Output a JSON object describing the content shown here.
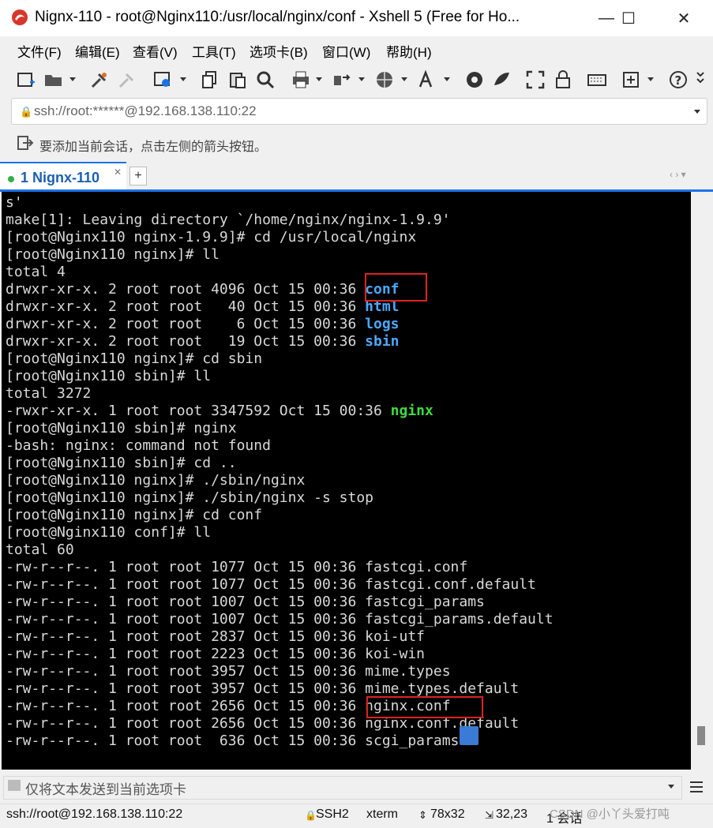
{
  "window": {
    "title": "Nignx-110 - root@Nginx110:/usr/local/nginx/conf - Xshell 5 (Free for Ho...",
    "minimize_glyph": "—",
    "maximize_glyph": "☐",
    "close_glyph": "✕"
  },
  "menu": [
    "文件(F)",
    "编辑(E)",
    "查看(V)",
    "工具(T)",
    "选项卡(B)",
    "窗口(W)",
    "帮助(H)"
  ],
  "address": {
    "value": "ssh://root:******@192.168.138.110:22"
  },
  "hint": {
    "text": "要添加当前会话，点击左侧的箭头按钮。"
  },
  "tabs": {
    "active_label": "1 Nignx-110",
    "add_label": "+",
    "nav_label": "‹ › ▾"
  },
  "terminal": {
    "lines": [
      "s'",
      "make[1]: Leaving directory `/home/nginx/nginx-1.9.9'",
      "[root@Nginx110 nginx-1.9.9]# cd /usr/local/nginx",
      "[root@Nginx110 nginx]# ll",
      "total 4",
      "drwxr-xr-x. 2 root root 4096 Oct 15 00:36 conf",
      "drwxr-xr-x. 2 root root   40 Oct 15 00:36 html",
      "drwxr-xr-x. 2 root root    6 Oct 15 00:36 logs",
      "drwxr-xr-x. 2 root root   19 Oct 15 00:36 sbin",
      "[root@Nginx110 nginx]# cd sbin",
      "[root@Nginx110 sbin]# ll",
      "total 3272",
      "-rwxr-xr-x. 1 root root 3347592 Oct 15 00:36 nginx",
      "[root@Nginx110 sbin]# nginx",
      "-bash: nginx: command not found",
      "[root@Nginx110 sbin]# cd ..",
      "[root@Nginx110 nginx]# ./sbin/nginx",
      "[root@Nginx110 nginx]# ./sbin/nginx -s stop",
      "[root@Nginx110 nginx]# cd conf",
      "[root@Nginx110 conf]# ll",
      "total 60",
      "-rw-r--r--. 1 root root 1077 Oct 15 00:36 fastcgi.conf",
      "-rw-r--r--. 1 root root 1077 Oct 15 00:36 fastcgi.conf.default",
      "-rw-r--r--. 1 root root 1007 Oct 15 00:36 fastcgi_params",
      "-rw-r--r--. 1 root root 1007 Oct 15 00:36 fastcgi_params.default",
      "-rw-r--r--. 1 root root 2837 Oct 15 00:36 koi-utf",
      "-rw-r--r--. 1 root root 2223 Oct 15 00:36 koi-win",
      "-rw-r--r--. 1 root root 3957 Oct 15 00:36 mime.types",
      "-rw-r--r--. 1 root root 3957 Oct 15 00:36 mime.types.default",
      "-rw-r--r--. 1 root root 2656 Oct 15 00:36 nginx.conf",
      "-rw-r--r--. 1 root root 2656 Oct 15 00:36 nginx.conf.default",
      "-rw-r--r--. 1 root root  636 Oct 15 00:36 scgi_params"
    ],
    "dir_names": [
      "conf",
      "html",
      "logs",
      "sbin"
    ],
    "exe_names": [
      "nginx"
    ],
    "colors": {
      "background": "#000000",
      "text": "#d8d8d8",
      "directory": "#4aa8ff",
      "executable": "#3ddc3d",
      "highlight_box": "#e02020"
    }
  },
  "sendbar": {
    "placeholder": "仅将文本发送到当前选项卡"
  },
  "status": {
    "connection": "ssh://root@192.168.138.110:22",
    "protocol": "SSH2",
    "term": "xterm",
    "size": "78x32",
    "cursor": "32,23",
    "sessions": "1 会话"
  },
  "watermark": "CSDN @小丫头爱打吨"
}
